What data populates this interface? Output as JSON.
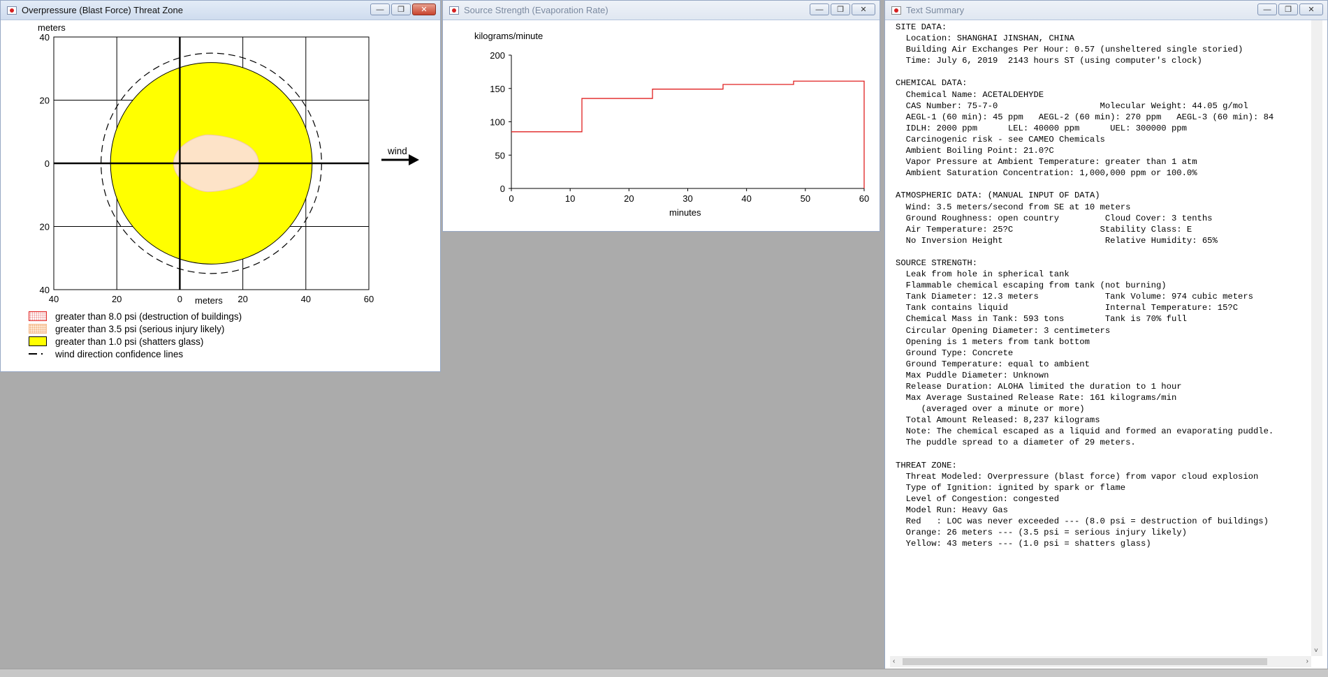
{
  "windows": {
    "threat_zone": {
      "title": "Overpressure (Blast Force) Threat Zone",
      "y_unit": "meters",
      "x_unit": "meters",
      "wind_label": "wind",
      "y_ticks": [
        "40",
        "20",
        "0",
        "20",
        "40"
      ],
      "x_ticks": [
        "40",
        "20",
        "0",
        "20",
        "40",
        "60"
      ],
      "legend": [
        {
          "label": "greater than 8.0 psi (destruction of buildings)",
          "swatch": "red-dotted"
        },
        {
          "label": "greater than 3.5 psi (serious injury likely)",
          "swatch": "orange-dotted"
        },
        {
          "label": "greater than 1.0 psi (shatters glass)",
          "swatch": "yellow"
        },
        {
          "label": "wind direction confidence lines",
          "swatch": "dash-line"
        }
      ]
    },
    "source_strength": {
      "title": "Source Strength (Evaporation Rate)"
    },
    "text_summary": {
      "title": "Text Summary",
      "lines": [
        "SITE DATA:",
        "  Location: SHANGHAI JINSHAN, CHINA",
        "  Building Air Exchanges Per Hour: 0.57 (unsheltered single storied)",
        "  Time: July 6, 2019  2143 hours ST (using computer's clock)",
        "",
        "CHEMICAL DATA:",
        "  Chemical Name: ACETALDEHYDE",
        "  CAS Number: 75-7-0                    Molecular Weight: 44.05 g/mol",
        "  AEGL-1 (60 min): 45 ppm   AEGL-2 (60 min): 270 ppm   AEGL-3 (60 min): 84",
        "  IDLH: 2000 ppm      LEL: 40000 ppm      UEL: 300000 ppm",
        "  Carcinogenic risk - see CAMEO Chemicals",
        "  Ambient Boiling Point: 21.0?C",
        "  Vapor Pressure at Ambient Temperature: greater than 1 atm",
        "  Ambient Saturation Concentration: 1,000,000 ppm or 100.0%",
        "",
        "ATMOSPHERIC DATA: (MANUAL INPUT OF DATA)",
        "  Wind: 3.5 meters/second from SE at 10 meters",
        "  Ground Roughness: open country         Cloud Cover: 3 tenths",
        "  Air Temperature: 25?C                 Stability Class: E",
        "  No Inversion Height                    Relative Humidity: 65%",
        "",
        "SOURCE STRENGTH:",
        "  Leak from hole in spherical tank",
        "  Flammable chemical escaping from tank (not burning)",
        "  Tank Diameter: 12.3 meters             Tank Volume: 974 cubic meters",
        "  Tank contains liquid                   Internal Temperature: 15?C",
        "  Chemical Mass in Tank: 593 tons        Tank is 70% full",
        "  Circular Opening Diameter: 3 centimeters",
        "  Opening is 1 meters from tank bottom",
        "  Ground Type: Concrete",
        "  Ground Temperature: equal to ambient",
        "  Max Puddle Diameter: Unknown",
        "  Release Duration: ALOHA limited the duration to 1 hour",
        "  Max Average Sustained Release Rate: 161 kilograms/min",
        "     (averaged over a minute or more)",
        "  Total Amount Released: 8,237 kilograms",
        "  Note: The chemical escaped as a liquid and formed an evaporating puddle.",
        "  The puddle spread to a diameter of 29 meters.",
        "",
        "THREAT ZONE:",
        "  Threat Modeled: Overpressure (blast force) from vapor cloud explosion",
        "  Type of Ignition: ignited by spark or flame",
        "  Level of Congestion: congested",
        "  Model Run: Heavy Gas",
        "  Red   : LOC was never exceeded --- (8.0 psi = destruction of buildings)",
        "  Orange: 26 meters --- (3.5 psi = serious injury likely)",
        "  Yellow: 43 meters --- (1.0 psi = shatters glass)"
      ]
    }
  },
  "chart_data": [
    {
      "type": "area",
      "title": "Overpressure (Blast Force) Threat Zone",
      "xlabel": "meters",
      "ylabel": "meters",
      "xlim": [
        -40,
        60
      ],
      "ylim": [
        -40,
        40
      ],
      "grid": true,
      "series": [
        {
          "name": "greater than 1.0 psi (shatters glass)",
          "color": "#ffff00",
          "center": [
            10,
            0
          ],
          "radius": 32
        },
        {
          "name": "greater than 3.5 psi (serious injury likely)",
          "color": "#fde3c8",
          "x_extent": [
            -2,
            25
          ],
          "y_extent": [
            -9,
            9
          ]
        },
        {
          "name": "wind direction confidence lines",
          "color": "#000000",
          "center": [
            10,
            0
          ],
          "radius": 35
        }
      ]
    },
    {
      "type": "line",
      "ylabel": "kilograms/minute",
      "xlabel": "minutes",
      "xlim": [
        0,
        60
      ],
      "ylim": [
        0,
        200
      ],
      "x_ticks": [
        0,
        10,
        20,
        30,
        40,
        50,
        60
      ],
      "y_ticks": [
        0,
        50,
        100,
        150,
        200
      ],
      "grid": false,
      "color": "#e02020",
      "x": [
        0,
        12,
        12,
        24,
        24,
        36,
        36,
        48,
        48,
        60,
        60
      ],
      "y": [
        85,
        85,
        135,
        135,
        149,
        149,
        156,
        156,
        161,
        161,
        0
      ]
    }
  ]
}
